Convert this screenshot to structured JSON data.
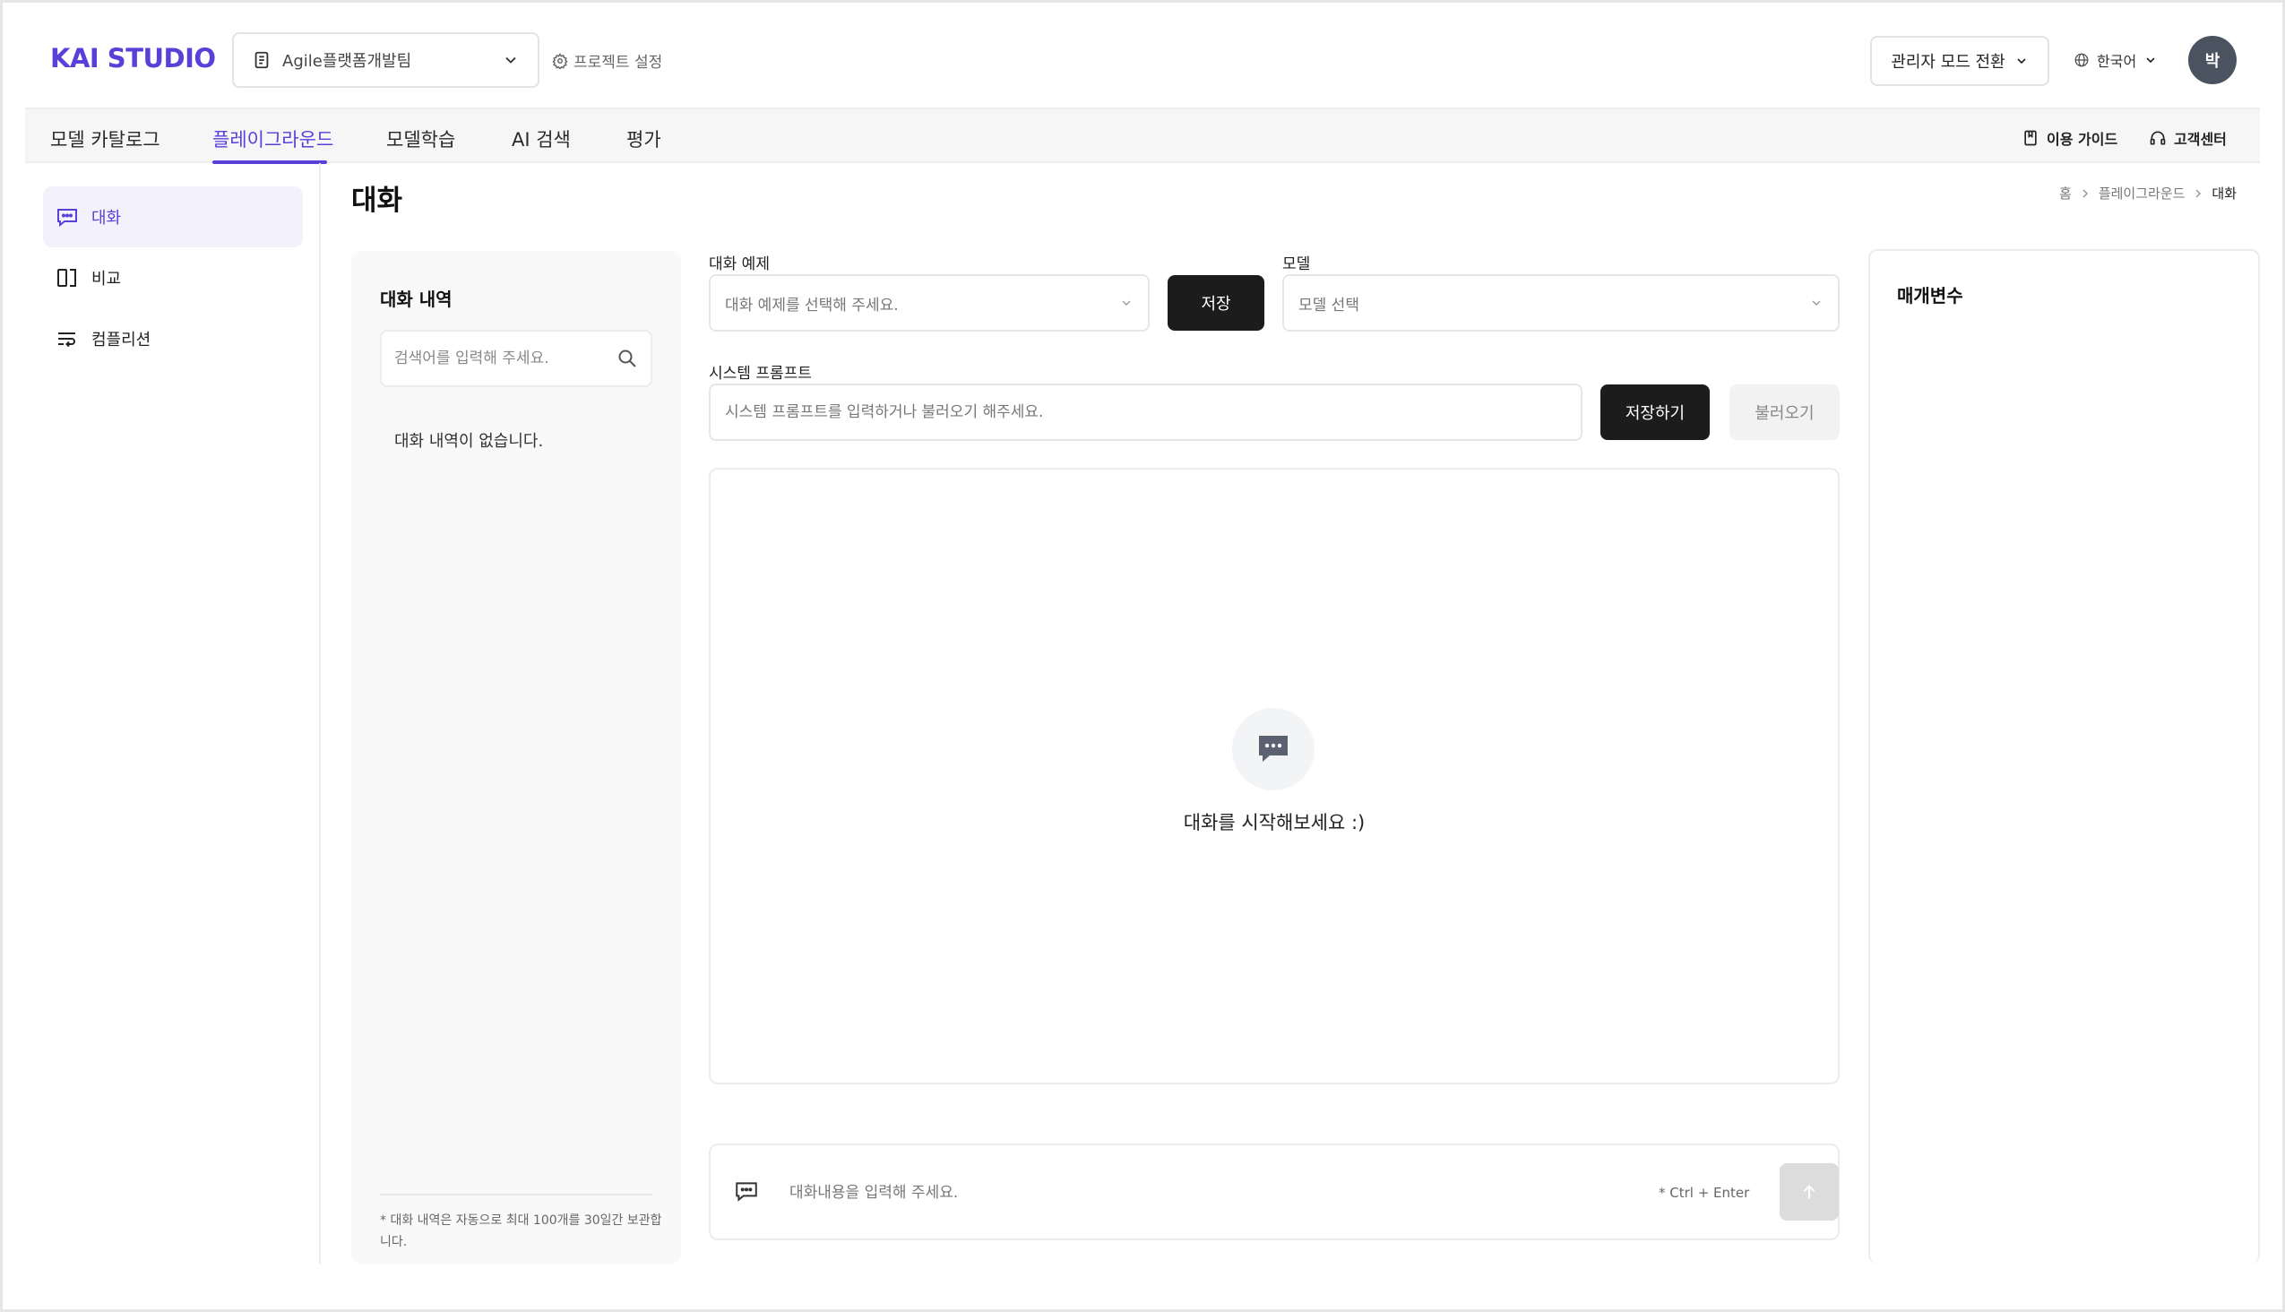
{
  "header": {
    "logo": "KAI STUDIO",
    "project_select": "Agile플랫폼개발팀",
    "project_settings": "프로젝트 설정",
    "admin_mode": "관리자 모드 전환",
    "language": "한국어",
    "avatar": "박"
  },
  "nav": {
    "tabs": [
      {
        "label": "모델 카탈로그"
      },
      {
        "label": "플레이그라운드"
      },
      {
        "label": "모델학습"
      },
      {
        "label": "AI 검색"
      },
      {
        "label": "평가"
      }
    ],
    "active_tab": "플레이그라운드",
    "guide": "이용 가이드",
    "support": "고객센터"
  },
  "sidebar": {
    "items": [
      {
        "label": "대화",
        "icon": "chat-icon"
      },
      {
        "label": "비교",
        "icon": "split-panel-icon"
      },
      {
        "label": "컴플리션",
        "icon": "text-wrap-icon"
      }
    ]
  },
  "page": {
    "title": "대화",
    "breadcrumb": [
      "홈",
      "플레이그라운드",
      "대화"
    ]
  },
  "history": {
    "title": "대화 내역",
    "search_placeholder": "검색어를 입력해 주세요.",
    "empty_text": "대화 내역이 없습니다.",
    "note": "* 대화 내역은 자동으로 최대 100개를 30일간 보관합니다."
  },
  "form": {
    "example_label": "대화 예제",
    "example_placeholder": "대화 예제를 선택해 주세요.",
    "save_label": "저장",
    "model_label": "모델",
    "model_placeholder": "모델 선택",
    "system_prompt_label": "시스템 프롬프트",
    "system_prompt_placeholder": "시스템 프롬프트를 입력하거나 불러오기 해주세요.",
    "save_prompt_label": "저장하기",
    "load_label": "불러오기"
  },
  "chat": {
    "empty_text": "대화를 시작해보세요 :)",
    "input_placeholder": "대화내용을 입력해 주세요.",
    "hint": "* Ctrl + Enter"
  },
  "params": {
    "title": "매개변수"
  },
  "colors": {
    "accent": "#5b3fd9",
    "dark_button": "#1c1c1c",
    "avatar_bg": "#4c5360"
  }
}
